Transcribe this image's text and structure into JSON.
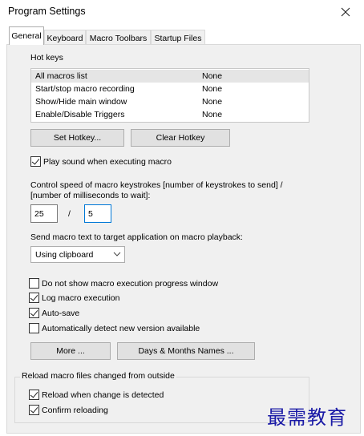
{
  "window": {
    "title": "Program Settings"
  },
  "tabs": [
    {
      "label": "General",
      "active": true
    },
    {
      "label": "Keyboard",
      "active": false
    },
    {
      "label": "Macro Toolbars",
      "active": false
    },
    {
      "label": "Startup Files",
      "active": false
    }
  ],
  "hotkeys": {
    "label": "Hot keys",
    "rows": [
      {
        "name": "All macros list",
        "key": "None",
        "selected": true
      },
      {
        "name": "Start/stop macro recording",
        "key": "None",
        "selected": false
      },
      {
        "name": "Show/Hide main window",
        "key": "None",
        "selected": false
      },
      {
        "name": "Enable/Disable Triggers",
        "key": "None",
        "selected": false
      }
    ],
    "set_button": "Set Hotkey...",
    "clear_button": "Clear Hotkey"
  },
  "play_sound": {
    "label": "Play sound when executing macro",
    "checked": true
  },
  "speed": {
    "label_line1": "Control speed of macro keystrokes [number of keystrokes to send] /",
    "label_line2": "[number of milliseconds to wait]:",
    "keystrokes": "25",
    "separator": "/",
    "milliseconds": "5"
  },
  "send_text": {
    "label": "Send macro text to target application on macro playback:",
    "selected": "Using clipboard"
  },
  "options": [
    {
      "label": "Do not show macro execution progress window",
      "checked": false
    },
    {
      "label": "Log macro execution",
      "checked": true
    },
    {
      "label": "Auto-save",
      "checked": true
    },
    {
      "label": "Automatically detect new version available",
      "checked": false
    }
  ],
  "buttons": {
    "more": "More ...",
    "days_months": "Days & Months Names ..."
  },
  "reload_group": {
    "title": "Reload macro files changed from outside",
    "options": [
      {
        "label": "Reload when change is detected",
        "checked": true
      },
      {
        "label": "Confirm reloading",
        "checked": true
      }
    ]
  },
  "watermark": "最需教育"
}
